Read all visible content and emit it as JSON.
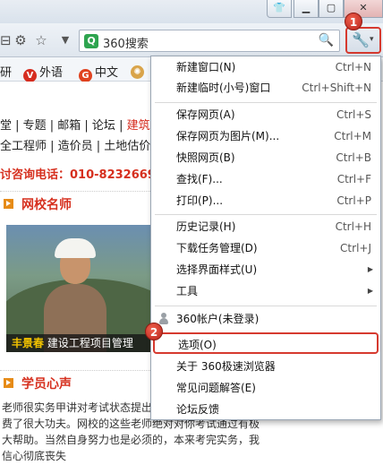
{
  "toolbar": {
    "search_label": "360搜索",
    "search_logo": "Q",
    "tools_icon": "wrench-icon",
    "tools_caret": "▾"
  },
  "bookmarks": [
    {
      "label": "研",
      "icon": ""
    },
    {
      "label": "外语",
      "icon": "V"
    },
    {
      "label": "中文",
      "icon": "G"
    },
    {
      "label": "",
      "icon": "✺"
    }
  ],
  "page": {
    "nav1": "堂 | 专题 | 邮箱 | 论坛 | ",
    "nav1_hot": "建筑书",
    "nav2": "全工程师 | 造价员 | 土地估价师",
    "hotline": "讨咨询电话：010-8232669",
    "section1": "网校名师",
    "caption_name": "丰景春",
    "caption_desc": "建设工程项目管理",
    "section2": "学员心声",
    "paragraph": "老师很实务甲讲对考试状态提出了老师的考前总结也是费了很大功夫。网校的这些老师绝对对你考试通过有极大帮助。当然自身努力也是必须的，本来考完实务，我信心彻底丧失"
  },
  "menu": {
    "items": [
      {
        "label": "新建窗口(N)",
        "shortcut": "Ctrl+N"
      },
      {
        "label": "新建临时(小号)窗口",
        "shortcut": "Ctrl+Shift+N"
      },
      {
        "label": "保存网页(A)",
        "shortcut": "Ctrl+S"
      },
      {
        "label": "保存网页为图片(M)...",
        "shortcut": "Ctrl+M"
      },
      {
        "label": "快照网页(B)",
        "shortcut": "Ctrl+B"
      },
      {
        "label": "查找(F)...",
        "shortcut": "Ctrl+F"
      },
      {
        "label": "打印(P)...",
        "shortcut": "Ctrl+P"
      },
      {
        "label": "历史记录(H)",
        "shortcut": "Ctrl+H"
      },
      {
        "label": "下载任务管理(D)",
        "shortcut": "Ctrl+J"
      },
      {
        "label": "选择界面样式(U)",
        "shortcut": ""
      },
      {
        "label": "工具",
        "shortcut": ""
      },
      {
        "label": "360帐户(未登录)",
        "shortcut": ""
      },
      {
        "label": "选项(O)",
        "shortcut": ""
      },
      {
        "label": "关于 360极速浏览器",
        "shortcut": ""
      },
      {
        "label": "常见问题解答(E)",
        "shortcut": ""
      },
      {
        "label": "论坛反馈",
        "shortcut": ""
      }
    ],
    "submenu_arrow": "▶"
  },
  "annotations": {
    "badge1": "1",
    "badge2": "2",
    "accent_color": "#d63a2f"
  }
}
